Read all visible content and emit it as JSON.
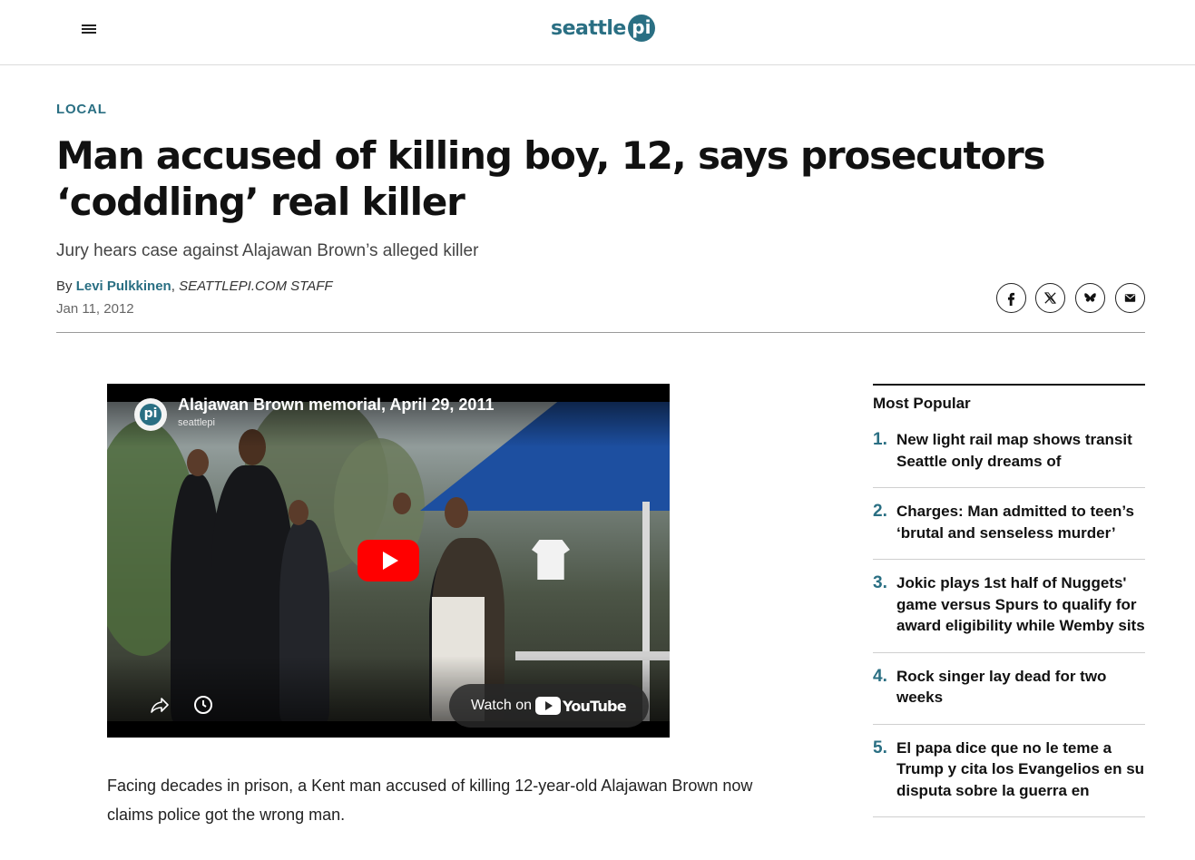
{
  "header": {
    "menu_icon": "hamburger-menu-icon",
    "logo_text": "seattle",
    "logo_pi": "pi"
  },
  "article": {
    "section": "LOCAL",
    "headline": "Man accused of killing boy, 12, says prosecutors ‘coddling’ real killer",
    "dek": "Jury hears case against Alajawan Brown’s alleged killer",
    "byline_prefix": "By",
    "author": "Levi Pulkkinen",
    "byline_sep": ",",
    "staff": "SEATTLEPI.COM STAFF",
    "date": "Jan 11, 2012",
    "share_icons": [
      "facebook-icon",
      "x-icon",
      "bluesky-icon",
      "email-icon"
    ],
    "body_paragraph": "Facing decades in prison, a Kent man accused of killing 12-year-old Alajawan Brown now claims police got the wrong man."
  },
  "video": {
    "title": "Alajawan Brown memorial, April 29, 2011",
    "channel": "seattlepi",
    "channel_avatar_text": "pi",
    "watch_on": "Watch on",
    "youtube": "YouTube",
    "icons": [
      "play-icon",
      "share-arrow-icon",
      "clock-icon"
    ]
  },
  "sidebar": {
    "title": "Most Popular",
    "items": [
      {
        "num": "1.",
        "text": "New light rail map shows transit Seattle only dreams of"
      },
      {
        "num": "2.",
        "text": "Charges: Man admitted to teen’s ‘brutal and senseless murder’"
      },
      {
        "num": "3.",
        "text": "Jokic plays 1st half of Nuggets' game versus Spurs to qualify for award eligibility while Wemby sits"
      },
      {
        "num": "4.",
        "text": "Rock singer lay dead for two weeks"
      },
      {
        "num": "5.",
        "text": "El papa dice que no le teme a Trump y cita los Evangelios en su disputa sobre la guerra en"
      }
    ]
  },
  "colors": {
    "brand": "#2a6f83",
    "text": "#111111",
    "youtube_red": "#ff0000"
  }
}
